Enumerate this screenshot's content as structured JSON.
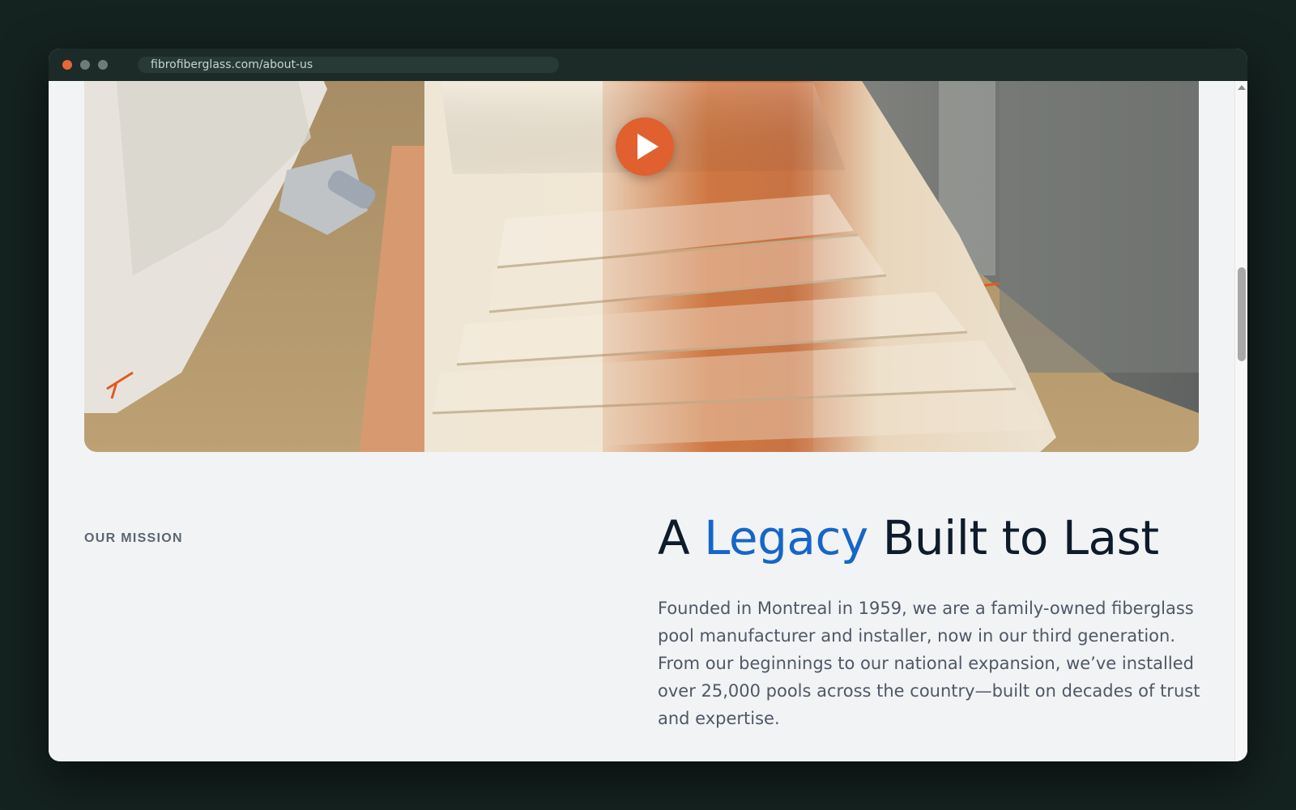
{
  "browser": {
    "url": "fibrofiberglass.com/about-us",
    "traffic_lights": {
      "close_color": "#e8673a",
      "minimize_color": "#707a78",
      "maximize_color": "#707a78"
    }
  },
  "video": {
    "play_icon": "play-icon",
    "play_button_color": "#e0602f"
  },
  "mission": {
    "section_label": "OUR MISSION",
    "heading_prefix": "A ",
    "heading_accent": "Legacy",
    "heading_suffix": " Built to Last",
    "accent_color": "#1666c7",
    "body": "Founded in Montreal in 1959, we are a family-owned fiberglass pool manufacturer and installer, now in our third generation. From our beginnings to our national expansion, we’ve installed over 25,000 pools across the country—built on decades of trust and expertise."
  },
  "scrollbar": {
    "up_icon": "scroll-up-arrow-icon"
  }
}
